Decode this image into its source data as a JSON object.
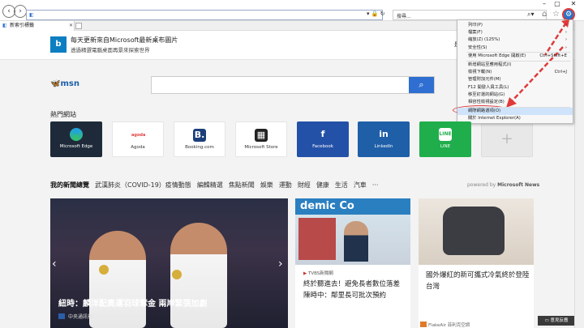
{
  "browser": {
    "address_value": "",
    "search_placeholder": "搜尋...",
    "tab_title": "新索引標籤"
  },
  "banner": {
    "logo_text": "b",
    "title": "每天更新來自Microsoft最新桌布圖片",
    "subtitle": "透過精選電腦桌面再景來探索世界",
    "right_text": "是"
  },
  "msn": {
    "logo": "msn",
    "search_value": ""
  },
  "top_sites": {
    "label": "熱門網站",
    "tiles": [
      {
        "name": "Microsoft Edge",
        "style": "dark",
        "icon": "e",
        "icon_color": "#1fa0e6"
      },
      {
        "name": "Agoda",
        "style": "light",
        "icon": "agoda",
        "icon_color": "#e43f3f"
      },
      {
        "name": "Booking.com",
        "style": "light",
        "icon": "B.",
        "icon_color": "#fff"
      },
      {
        "name": "Microsoft Store",
        "style": "light",
        "icon": "store",
        "icon_color": "#fff"
      },
      {
        "name": "Facebook",
        "style": "dark",
        "icon": "f",
        "icon_color": "#fff"
      },
      {
        "name": "LinkedIn",
        "style": "dark",
        "icon": "in",
        "icon_color": "#fff"
      },
      {
        "name": "LINE",
        "style": "dark",
        "icon": "LINE",
        "icon_color": "#fff"
      }
    ],
    "add_tile": "+"
  },
  "news_nav": {
    "items": [
      "我的新聞總覽",
      "武漢肺炎（COVID-19）疫情動態",
      "編輯精選",
      "焦點新聞",
      "娛樂",
      "運動",
      "財經",
      "健康",
      "生活",
      "汽車",
      "···"
    ],
    "powered_prefix": "powered by",
    "powered_brand": "Microsoft News"
  },
  "hero": {
    "title": "紐時：麟洋配奧運羽球奪金 兩岸緊張加劇",
    "source": "中央通訊社"
  },
  "card2": {
    "source": "TVBS新聞網",
    "title": "終於聽進去！避免長者數位落差 陳時中：鄰里長可批次預約",
    "banner_text": "demic Co"
  },
  "card3": {
    "title": "國外爆紅的新可攜式冷氣終於登陸台灣",
    "source": "FlakeAir 菲利克空調"
  },
  "feedback": "意見反應",
  "menu": {
    "items": [
      {
        "label": "列印(P)",
        "shortcut": "›"
      },
      {
        "label": "檔案(F)",
        "shortcut": "›"
      },
      {
        "label": "縮放(Z) (125%)",
        "shortcut": "›"
      },
      {
        "label": "安全性(S)",
        "shortcut": "›"
      },
      {
        "label": "使用 Microsoft Edge 開啟(E)",
        "shortcut": "Ctrl+Shift+E"
      },
      {
        "label": "新增網站至應用程式(I)",
        "shortcut": ""
      },
      {
        "label": "檢視下載(N)",
        "shortcut": "Ctrl+J"
      },
      {
        "label": "管理附加元件(M)",
        "shortcut": ""
      },
      {
        "label": "F12 開發人員工具(L)",
        "shortcut": ""
      },
      {
        "label": "移至釘選的網站(G)",
        "shortcut": ""
      },
      {
        "label": "相容性檢視設定(B)",
        "shortcut": ""
      },
      {
        "label": "網際網路選項(O)",
        "shortcut": ""
      },
      {
        "label": "關於 Internet Explorer(A)",
        "shortcut": ""
      }
    ],
    "highlighted_index": 11
  },
  "colors": {
    "accent": "#2f6fd1",
    "annotation_red": "#e03a3a",
    "menu_highlight": "#cfe4fb"
  }
}
